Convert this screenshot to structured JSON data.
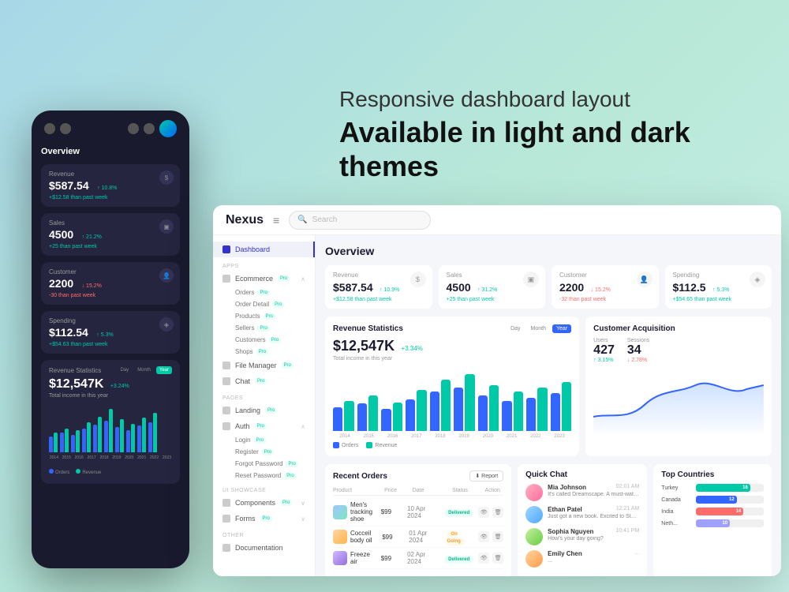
{
  "hero": {
    "subtitle": "Responsive dashboard layout",
    "title": "Available in light and dark themes"
  },
  "mobile": {
    "overview_label": "Overview",
    "revenue": {
      "label": "Revenue",
      "value": "$587.54",
      "growth": "↑ 10.8%",
      "sub": "+$12.58 than past week"
    },
    "sales": {
      "label": "Sales",
      "value": "4500",
      "growth": "↑ 21.2%",
      "sub": "+25 than past week"
    },
    "customer": {
      "label": "Customer",
      "value": "2200",
      "growth": "↓ 15.2%",
      "sub": "-30 than past week"
    },
    "spending": {
      "label": "Spending",
      "value": "$112.54",
      "growth": "↑ 5.3%",
      "sub": "+$54.63 than past week"
    },
    "stats": {
      "label": "Revenue Statistics",
      "value": "$12,547K",
      "growth": "+3.24%",
      "sub": "Total income in this year",
      "tabs": [
        "Day",
        "Month",
        "Year"
      ]
    },
    "chart_labels": [
      "2014",
      "2015",
      "2016",
      "2017",
      "2018",
      "2019",
      "2020",
      "2021",
      "2022",
      "2023"
    ]
  },
  "desktop": {
    "logo": "Nexus",
    "search_placeholder": "Search",
    "topbar_menu": "≡",
    "overview_label": "Overview",
    "sidebar": {
      "dashboard_label": "Dashboard",
      "apps_label": "Apps",
      "ecommerce_label": "Ecommerce",
      "ecommerce_badge": "Pro",
      "orders_label": "Orders",
      "orders_badge": "Pro",
      "order_detail_label": "Order Detail",
      "order_detail_badge": "Pro",
      "products_label": "Products",
      "products_badge": "Pro",
      "sellers_label": "Sellers",
      "sellers_badge": "Pro",
      "customers_label": "Customers",
      "customers_badge": "Pro",
      "shops_label": "Shops",
      "shops_badge": "Pro",
      "file_manager_label": "File Manager",
      "file_manager_badge": "Pro",
      "chat_label": "Chat",
      "chat_badge": "Pro",
      "pages_label": "Pages",
      "landing_label": "Landing",
      "landing_badge": "Pro",
      "auth_label": "Auth",
      "auth_badge": "Pro",
      "login_label": "Login",
      "login_badge": "Pro",
      "register_label": "Register",
      "register_badge": "Pro",
      "forgot_password_label": "Forgot Password",
      "forgot_password_badge": "Pro",
      "reset_password_label": "Reset Password",
      "reset_password_badge": "Pro",
      "ui_showcase_label": "UI Showcase",
      "components_label": "Components",
      "components_badge": "Pro",
      "forms_label": "Forms",
      "forms_badge": "Pro",
      "other_label": "Other",
      "documentation_label": "Documentation"
    },
    "stats": {
      "revenue": {
        "label": "Revenue",
        "value": "$587.54",
        "growth": "↑ 10.9%",
        "sub": "+$12.58 than past week"
      },
      "sales": {
        "label": "Sales",
        "value": "4500",
        "growth": "↑ 31.2%",
        "sub": "+25 than past week"
      },
      "customer": {
        "label": "Customer",
        "value": "2200",
        "growth": "↓ 15.2%",
        "sub": "-32 than past week"
      },
      "spending": {
        "label": "Spending",
        "value": "$112.5",
        "growth": "↑ 5.3%",
        "sub": "+$54.65 than past week"
      }
    },
    "revenue_stats": {
      "title": "Revenue Statistics",
      "value": "$12,547K",
      "growth": "+3.34%",
      "sub": "Total income in this year",
      "tabs": [
        "Day",
        "Month",
        "Year"
      ],
      "active_tab": "Year",
      "labels": [
        "2014",
        "2015",
        "2016",
        "2017",
        "2018",
        "2019",
        "2020",
        "2021",
        "2022",
        "2023"
      ],
      "orders_legend": "Orders",
      "revenue_legend": "Revenue"
    },
    "customer_acquisition": {
      "title": "Customer Acquisition",
      "users_label": "Users",
      "users_value": "427",
      "users_growth": "↑ 3.15%",
      "sessions_label": "Sessions",
      "sessions_value": "34",
      "sessions_growth": "↓ 2.78%"
    },
    "recent_orders": {
      "title": "Recent Orders",
      "report_btn": "⬇ Report",
      "cols": [
        "Product",
        "Price",
        "Date",
        "Status",
        "Action"
      ],
      "rows": [
        {
          "product": "Men's tracking shoe",
          "price": "$99",
          "date": "10 Apr 2024",
          "status": "Delivered"
        },
        {
          "product": "Cocceil body oil",
          "price": "$99",
          "date": "01 Apr 2024",
          "status": "On Going"
        },
        {
          "product": "Freeze air",
          "price": "$99",
          "date": "02 Apr 2024",
          "status": "Delivered"
        }
      ]
    },
    "quick_chat": {
      "title": "Quick Chat",
      "messages": [
        {
          "name": "Mia Johnson",
          "time": "02:01 AM",
          "msg": "It's called Dreamscape. A must-watch!"
        },
        {
          "name": "Ethan Patel",
          "time": "12:21 AM",
          "msg": "Just got a new book. Excited to Start..."
        },
        {
          "name": "Sophia Nguyen",
          "time": "10:41 PM",
          "msg": "How's your day going?"
        },
        {
          "name": "Emily Chen",
          "time": "...",
          "msg": ""
        }
      ]
    },
    "top_countries": {
      "title": "Top Countries",
      "countries": [
        {
          "name": "Turkey",
          "value": 16,
          "color": "#00c9a7",
          "label": "16"
        },
        {
          "name": "Canada",
          "value": 12,
          "color": "#3366ff",
          "label": "12"
        },
        {
          "name": "India",
          "value": 14,
          "color": "#ff6b6b",
          "label": "14"
        },
        {
          "name": "Neth...",
          "value": 10,
          "color": "#a0a0ff",
          "label": "10"
        }
      ]
    }
  }
}
